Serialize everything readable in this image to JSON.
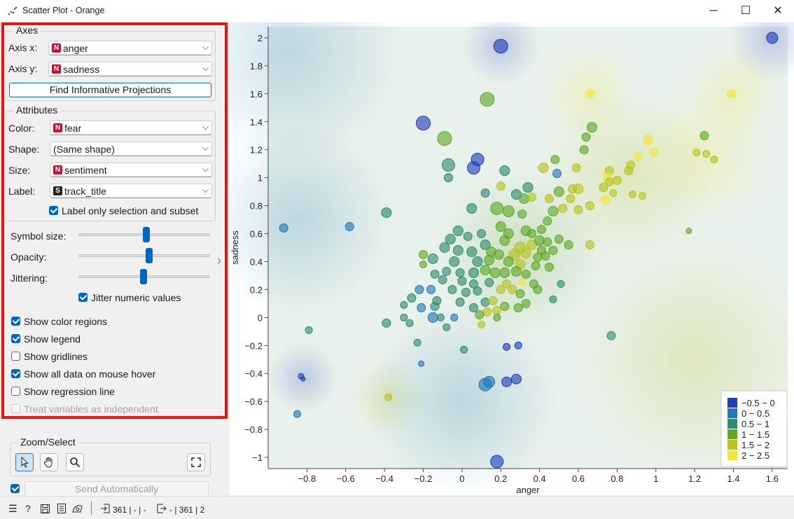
{
  "window": {
    "title": "Scatter Plot - Orange",
    "minimize": "─",
    "maximize": "☐",
    "close": "✕"
  },
  "axes": {
    "group_title": "Axes",
    "x_label": "Axis x:",
    "x_value": "anger",
    "y_label": "Axis y:",
    "y_value": "sadness",
    "find_button": "Find Informative Projections"
  },
  "attributes": {
    "group_title": "Attributes",
    "color_label": "Color:",
    "color_value": "fear",
    "shape_label": "Shape:",
    "shape_value": "(Same shape)",
    "size_label": "Size:",
    "size_value": "sentiment",
    "label_label": "Label:",
    "label_value": "track_title",
    "label_only_selection": "Label only selection and subset",
    "badge_numeric": "N",
    "badge_string": "S"
  },
  "sliders": {
    "symbol_size_label": "Symbol size:",
    "symbol_size": 0.76,
    "opacity_label": "Opacity:",
    "opacity": 0.78,
    "jittering_label": "Jittering:",
    "jittering": 0.74,
    "jitter_numeric": "Jitter numeric values"
  },
  "options": {
    "show_color_regions": "Show color regions",
    "show_legend": "Show legend",
    "show_gridlines": "Show gridlines",
    "show_all_data": "Show all data on mouse hover",
    "show_regression": "Show regression line",
    "treat_independent": "Treat variables as independent"
  },
  "zoom": {
    "group_title": "Zoom/Select",
    "select_icon": "pointer-icon",
    "pan_icon": "hand-icon",
    "zoom_icon": "magnifier-icon",
    "reset_icon": "fullscreen-icon"
  },
  "send": {
    "label": "Send Automatically"
  },
  "status": {
    "input_count": "361 | - | -",
    "output_count": "- | 361 | 2"
  },
  "chart_data": {
    "type": "scatter",
    "xlabel": "anger",
    "ylabel": "sadness",
    "xlim": [
      -1.0,
      1.68
    ],
    "ylim": [
      -1.08,
      2.08
    ],
    "xticks": [
      "−0.8",
      "−0.6",
      "−0.4",
      "−0.2",
      "0",
      "0.2",
      "0.4",
      "0.6",
      "0.8",
      "1",
      "1.2",
      "1.4",
      "1.6"
    ],
    "xtick_values": [
      -0.8,
      -0.6,
      -0.4,
      -0.2,
      0,
      0.2,
      0.4,
      0.6,
      0.8,
      1,
      1.2,
      1.4,
      1.6
    ],
    "yticks": [
      "2",
      "1.8",
      "1.6",
      "1.4",
      "1.2",
      "1",
      "0.8",
      "0.6",
      "0.4",
      "0.2",
      "0",
      "−0.2",
      "−0.4",
      "−0.6",
      "−0.8",
      "−1"
    ],
    "ytick_values": [
      2,
      1.8,
      1.6,
      1.4,
      1.2,
      1,
      0.8,
      0.6,
      0.4,
      0.2,
      0,
      -0.2,
      -0.4,
      -0.6,
      -0.8,
      -1
    ],
    "legend_position": "bottom-right",
    "legend": [
      "−0.5 − 0",
      "0 − 0.5",
      "0.5 − 1",
      "1 − 1.5",
      "1.5 − 2",
      "2 − 2.5"
    ],
    "legend_colors": [
      "#1f3fb8",
      "#1f78b4",
      "#2e8b6e",
      "#5ea826",
      "#b8c41a",
      "#f2e43a"
    ],
    "points": [
      {
        "x": 1.6,
        "y": 2.0,
        "s": 8,
        "c": 0
      },
      {
        "x": 0.2,
        "y": 1.94,
        "s": 10,
        "c": 0
      },
      {
        "x": 0.13,
        "y": 1.56,
        "s": 10,
        "c": 3
      },
      {
        "x": 0.66,
        "y": 1.6,
        "s": 6,
        "c": 5
      },
      {
        "x": 1.39,
        "y": 1.6,
        "s": 6,
        "c": 5
      },
      {
        "x": -0.2,
        "y": 1.39,
        "s": 10,
        "c": 0
      },
      {
        "x": -0.09,
        "y": 1.28,
        "s": 10,
        "c": 3
      },
      {
        "x": 0.67,
        "y": 1.36,
        "s": 7,
        "c": 3
      },
      {
        "x": 0.64,
        "y": 1.29,
        "s": 6,
        "c": 3
      },
      {
        "x": 0.63,
        "y": 1.2,
        "s": 6,
        "c": 3
      },
      {
        "x": 1.25,
        "y": 1.3,
        "s": 6,
        "c": 3
      },
      {
        "x": 0.96,
        "y": 1.27,
        "s": 7,
        "c": 5
      },
      {
        "x": 0.91,
        "y": 1.15,
        "s": 6,
        "c": 5
      },
      {
        "x": 0.99,
        "y": 1.18,
        "s": 6,
        "c": 5
      },
      {
        "x": 1.21,
        "y": 1.18,
        "s": 5,
        "c": 4
      },
      {
        "x": 1.26,
        "y": 1.17,
        "s": 5,
        "c": 4
      },
      {
        "x": 1.3,
        "y": 1.13,
        "s": 5,
        "c": 4
      },
      {
        "x": 0.08,
        "y": 1.13,
        "s": 9,
        "c": 0
      },
      {
        "x": 0.06,
        "y": 1.07,
        "s": 9,
        "c": 0
      },
      {
        "x": -0.07,
        "y": 1.09,
        "s": 9,
        "c": 2
      },
      {
        "x": -0.07,
        "y": 1.0,
        "s": 6,
        "c": 2
      },
      {
        "x": 0.22,
        "y": 1.05,
        "s": 7,
        "c": 2
      },
      {
        "x": 0.49,
        "y": 1.03,
        "s": 6,
        "c": 1
      },
      {
        "x": 0.42,
        "y": 1.07,
        "s": 7,
        "c": 4
      },
      {
        "x": 0.48,
        "y": 1.13,
        "s": 6,
        "c": 3
      },
      {
        "x": 0.59,
        "y": 1.07,
        "s": 6,
        "c": 4
      },
      {
        "x": 0.76,
        "y": 1.05,
        "s": 6,
        "c": 4
      },
      {
        "x": 0.87,
        "y": 1.09,
        "s": 6,
        "c": 4
      },
      {
        "x": 0.86,
        "y": 1.05,
        "s": 6,
        "c": 4
      },
      {
        "x": 0.75,
        "y": 1.0,
        "s": 6,
        "c": 5
      },
      {
        "x": 0.76,
        "y": 0.97,
        "s": 6,
        "c": 4
      },
      {
        "x": 0.8,
        "y": 0.98,
        "s": 6,
        "c": 4
      },
      {
        "x": 0.73,
        "y": 0.93,
        "s": 6,
        "c": 4
      },
      {
        "x": 0.78,
        "y": 0.89,
        "s": 5,
        "c": 4
      },
      {
        "x": 0.88,
        "y": 0.88,
        "s": 5,
        "c": 4
      },
      {
        "x": 0.93,
        "y": 0.87,
        "s": 5,
        "c": 4
      },
      {
        "x": 0.74,
        "y": 0.84,
        "s": 6,
        "c": 5
      },
      {
        "x": 0.66,
        "y": 0.8,
        "s": 6,
        "c": 4
      },
      {
        "x": 0.6,
        "y": 0.92,
        "s": 7,
        "c": 4
      },
      {
        "x": 0.57,
        "y": 0.92,
        "s": 6,
        "c": 4
      },
      {
        "x": 0.5,
        "y": 0.9,
        "s": 7,
        "c": 3
      },
      {
        "x": 0.34,
        "y": 0.93,
        "s": 7,
        "c": 2
      },
      {
        "x": 0.28,
        "y": 0.88,
        "s": 7,
        "c": 2
      },
      {
        "x": 0.2,
        "y": 0.94,
        "s": 6,
        "c": 4
      },
      {
        "x": 0.12,
        "y": 0.89,
        "s": 6,
        "c": 2
      },
      {
        "x": 0.32,
        "y": 0.85,
        "s": 7,
        "c": 3
      },
      {
        "x": 0.36,
        "y": 0.86,
        "s": 6,
        "c": 4
      },
      {
        "x": 0.45,
        "y": 0.85,
        "s": 6,
        "c": 4
      },
      {
        "x": 0.56,
        "y": 0.85,
        "s": 6,
        "c": 4
      },
      {
        "x": 0.47,
        "y": 0.76,
        "s": 7,
        "c": 3
      },
      {
        "x": 0.52,
        "y": 0.78,
        "s": 6,
        "c": 4
      },
      {
        "x": 0.6,
        "y": 0.77,
        "s": 6,
        "c": 4
      },
      {
        "x": -0.39,
        "y": 0.75,
        "s": 7,
        "c": 2
      },
      {
        "x": -0.92,
        "y": 0.64,
        "s": 6,
        "c": 1
      },
      {
        "x": -0.58,
        "y": 0.65,
        "s": 6,
        "c": 1
      },
      {
        "x": 0.05,
        "y": 0.78,
        "s": 7,
        "c": 2
      },
      {
        "x": 0.18,
        "y": 0.78,
        "s": 9,
        "c": 3
      },
      {
        "x": 0.24,
        "y": 0.76,
        "s": 8,
        "c": 3
      },
      {
        "x": 0.31,
        "y": 0.74,
        "s": 6,
        "c": 3
      },
      {
        "x": 0.44,
        "y": 0.69,
        "s": 6,
        "c": 3
      },
      {
        "x": 0.41,
        "y": 0.63,
        "s": 6,
        "c": 3
      },
      {
        "x": 1.17,
        "y": 0.62,
        "s": 4,
        "c": 3
      },
      {
        "x": -0.02,
        "y": 0.62,
        "s": 7,
        "c": 2
      },
      {
        "x": 0.03,
        "y": 0.58,
        "s": 6,
        "c": 2
      },
      {
        "x": 0.1,
        "y": 0.6,
        "s": 6,
        "c": 2
      },
      {
        "x": 0.2,
        "y": 0.65,
        "s": 7,
        "c": 3
      },
      {
        "x": 0.24,
        "y": 0.6,
        "s": 7,
        "c": 3
      },
      {
        "x": 0.33,
        "y": 0.62,
        "s": 7,
        "c": 3
      },
      {
        "x": 0.36,
        "y": 0.6,
        "s": 6,
        "c": 3
      },
      {
        "x": -0.06,
        "y": 0.56,
        "s": 7,
        "c": 2
      },
      {
        "x": 0.12,
        "y": 0.52,
        "s": 7,
        "c": 2
      },
      {
        "x": 0.22,
        "y": 0.55,
        "s": 7,
        "c": 3
      },
      {
        "x": 0.3,
        "y": 0.5,
        "s": 8,
        "c": 4
      },
      {
        "x": 0.36,
        "y": 0.52,
        "s": 7,
        "c": 4
      },
      {
        "x": 0.4,
        "y": 0.55,
        "s": 7,
        "c": 3
      },
      {
        "x": 0.41,
        "y": 0.48,
        "s": 6,
        "c": 3
      },
      {
        "x": 0.44,
        "y": 0.54,
        "s": 6,
        "c": 3
      },
      {
        "x": 0.5,
        "y": 0.56,
        "s": 6,
        "c": 3
      },
      {
        "x": 0.55,
        "y": 0.52,
        "s": 6,
        "c": 3
      },
      {
        "x": 0.66,
        "y": 0.52,
        "s": 6,
        "c": 4
      },
      {
        "x": -0.09,
        "y": 0.5,
        "s": 7,
        "c": 2
      },
      {
        "x": -0.02,
        "y": 0.48,
        "s": 7,
        "c": 2
      },
      {
        "x": 0.05,
        "y": 0.47,
        "s": 7,
        "c": 2
      },
      {
        "x": 0.15,
        "y": 0.47,
        "s": 7,
        "c": 3
      },
      {
        "x": 0.19,
        "y": 0.45,
        "s": 7,
        "c": 3
      },
      {
        "x": 0.27,
        "y": 0.45,
        "s": 8,
        "c": 4
      },
      {
        "x": 0.33,
        "y": 0.46,
        "s": 7,
        "c": 4
      },
      {
        "x": 0.39,
        "y": 0.43,
        "s": 6,
        "c": 3
      },
      {
        "x": 0.43,
        "y": 0.44,
        "s": 6,
        "c": 3
      },
      {
        "x": 0.47,
        "y": 0.48,
        "s": 6,
        "c": 3
      },
      {
        "x": -0.2,
        "y": 0.45,
        "s": 6,
        "c": 3
      },
      {
        "x": -0.2,
        "y": 0.38,
        "s": 5,
        "c": 3
      },
      {
        "x": -0.15,
        "y": 0.42,
        "s": 7,
        "c": 2
      },
      {
        "x": -0.04,
        "y": 0.4,
        "s": 7,
        "c": 2
      },
      {
        "x": 0.08,
        "y": 0.4,
        "s": 7,
        "c": 2
      },
      {
        "x": 0.14,
        "y": 0.41,
        "s": 7,
        "c": 3
      },
      {
        "x": 0.24,
        "y": 0.4,
        "s": 7,
        "c": 3
      },
      {
        "x": 0.3,
        "y": 0.38,
        "s": 7,
        "c": 4
      },
      {
        "x": 0.38,
        "y": 0.37,
        "s": 6,
        "c": 3
      },
      {
        "x": 0.45,
        "y": 0.36,
        "s": 6,
        "c": 3
      },
      {
        "x": -0.14,
        "y": 0.31,
        "s": 6,
        "c": 2
      },
      {
        "x": -0.08,
        "y": 0.33,
        "s": 6,
        "c": 2
      },
      {
        "x": -0.01,
        "y": 0.32,
        "s": 6,
        "c": 2
      },
      {
        "x": 0.06,
        "y": 0.32,
        "s": 7,
        "c": 2
      },
      {
        "x": 0.12,
        "y": 0.34,
        "s": 7,
        "c": 3
      },
      {
        "x": 0.17,
        "y": 0.32,
        "s": 7,
        "c": 3
      },
      {
        "x": 0.22,
        "y": 0.32,
        "s": 7,
        "c": 3
      },
      {
        "x": 0.28,
        "y": 0.33,
        "s": 7,
        "c": 3
      },
      {
        "x": 0.33,
        "y": 0.31,
        "s": 6,
        "c": 3
      },
      {
        "x": -0.1,
        "y": 0.27,
        "s": 6,
        "c": 2
      },
      {
        "x": 0.0,
        "y": 0.26,
        "s": 6,
        "c": 2
      },
      {
        "x": 0.06,
        "y": 0.24,
        "s": 6,
        "c": 2
      },
      {
        "x": 0.14,
        "y": 0.25,
        "s": 6,
        "c": 2
      },
      {
        "x": 0.23,
        "y": 0.24,
        "s": 6,
        "c": 4
      },
      {
        "x": 0.31,
        "y": 0.25,
        "s": 5,
        "c": 5
      },
      {
        "x": 0.37,
        "y": 0.24,
        "s": 6,
        "c": 3
      },
      {
        "x": 0.51,
        "y": 0.24,
        "s": 5,
        "c": 2
      },
      {
        "x": -0.22,
        "y": 0.2,
        "s": 6,
        "c": 1
      },
      {
        "x": -0.16,
        "y": 0.2,
        "s": 6,
        "c": 1
      },
      {
        "x": -0.05,
        "y": 0.2,
        "s": 6,
        "c": 2
      },
      {
        "x": 0.02,
        "y": 0.18,
        "s": 6,
        "c": 2
      },
      {
        "x": 0.08,
        "y": 0.19,
        "s": 6,
        "c": 2
      },
      {
        "x": 0.2,
        "y": 0.2,
        "s": 6,
        "c": 4
      },
      {
        "x": 0.26,
        "y": 0.2,
        "s": 6,
        "c": 4
      },
      {
        "x": 0.3,
        "y": 0.17,
        "s": 6,
        "c": 3
      },
      {
        "x": 0.39,
        "y": 0.2,
        "s": 6,
        "c": 3
      },
      {
        "x": -0.26,
        "y": 0.14,
        "s": 6,
        "c": 2
      },
      {
        "x": -0.13,
        "y": 0.12,
        "s": 6,
        "c": 2
      },
      {
        "x": -0.01,
        "y": 0.11,
        "s": 6,
        "c": 2
      },
      {
        "x": 0.12,
        "y": 0.11,
        "s": 6,
        "c": 2
      },
      {
        "x": 0.16,
        "y": 0.12,
        "s": 6,
        "c": 4
      },
      {
        "x": 0.22,
        "y": 0.08,
        "s": 6,
        "c": 3
      },
      {
        "x": 0.33,
        "y": 0.1,
        "s": 6,
        "c": 3
      },
      {
        "x": 0.47,
        "y": 0.13,
        "s": 5,
        "c": 2
      },
      {
        "x": -0.3,
        "y": 0.09,
        "s": 5,
        "c": 2
      },
      {
        "x": -0.21,
        "y": 0.07,
        "s": 6,
        "c": 1
      },
      {
        "x": -0.14,
        "y": 0.08,
        "s": 6,
        "c": 2
      },
      {
        "x": 0.06,
        "y": 0.07,
        "s": 6,
        "c": 2
      },
      {
        "x": 0.13,
        "y": 0.04,
        "s": 6,
        "c": 4
      },
      {
        "x": 0.18,
        "y": 0.05,
        "s": 6,
        "c": 4
      },
      {
        "x": 0.29,
        "y": 0.07,
        "s": 6,
        "c": 3
      },
      {
        "x": -0.15,
        "y": 0.0,
        "s": 7,
        "c": 1
      },
      {
        "x": -0.11,
        "y": 0.0,
        "s": 5,
        "c": 2
      },
      {
        "x": -0.04,
        "y": 0.0,
        "s": 5,
        "c": 1
      },
      {
        "x": 0.09,
        "y": 0.02,
        "s": 6,
        "c": 3
      },
      {
        "x": 0.18,
        "y": 0.0,
        "s": 5,
        "c": 3
      },
      {
        "x": -0.39,
        "y": -0.04,
        "s": 6,
        "c": 2
      },
      {
        "x": -0.3,
        "y": 0.0,
        "s": 5,
        "c": 2
      },
      {
        "x": -0.27,
        "y": -0.04,
        "s": 5,
        "c": 2
      },
      {
        "x": -0.08,
        "y": -0.07,
        "s": 5,
        "c": 2
      },
      {
        "x": 0.1,
        "y": -0.05,
        "s": 5,
        "c": 4
      },
      {
        "x": -0.79,
        "y": -0.09,
        "s": 5,
        "c": 2
      },
      {
        "x": 0.77,
        "y": -0.13,
        "s": 6,
        "c": 2
      },
      {
        "x": -0.23,
        "y": -0.18,
        "s": 5,
        "c": 2
      },
      {
        "x": 0.01,
        "y": -0.23,
        "s": 5,
        "c": 2
      },
      {
        "x": 0.23,
        "y": -0.21,
        "s": 5,
        "c": 0
      },
      {
        "x": 0.29,
        "y": -0.2,
        "s": 5,
        "c": 0
      },
      {
        "x": -0.21,
        "y": -0.33,
        "s": 4,
        "c": 1
      },
      {
        "x": 0.12,
        "y": -0.48,
        "s": 9,
        "c": 1
      },
      {
        "x": 0.14,
        "y": -0.46,
        "s": 8,
        "c": 1
      },
      {
        "x": 0.23,
        "y": -0.46,
        "s": 7,
        "c": 0
      },
      {
        "x": 0.28,
        "y": -0.44,
        "s": 7,
        "c": 0
      },
      {
        "x": -0.83,
        "y": -0.42,
        "s": 4,
        "c": 0
      },
      {
        "x": -0.82,
        "y": -0.44,
        "s": 3,
        "c": 0
      },
      {
        "x": -0.38,
        "y": -0.57,
        "s": 5,
        "c": 4
      },
      {
        "x": -0.85,
        "y": -0.69,
        "s": 5,
        "c": 1
      },
      {
        "x": 0.18,
        "y": -1.03,
        "s": 9,
        "c": 0
      }
    ],
    "regions": [
      {
        "x": 1.6,
        "y": 2.0,
        "r": 0.22,
        "c": 0
      },
      {
        "x": 0.2,
        "y": 1.94,
        "r": 0.2,
        "c": 0
      },
      {
        "x": -0.9,
        "y": 1.9,
        "r": 0.6,
        "c": 1
      },
      {
        "x": -0.85,
        "y": 0.7,
        "r": 0.5,
        "c": 1
      },
      {
        "x": -0.82,
        "y": -0.43,
        "r": 0.18,
        "c": 0
      },
      {
        "x": -0.38,
        "y": -0.57,
        "r": 0.2,
        "c": 4
      },
      {
        "x": 0.3,
        "y": 0.45,
        "r": 0.45,
        "c": 3
      },
      {
        "x": 0.85,
        "y": 1.0,
        "r": 0.45,
        "c": 4
      },
      {
        "x": 1.25,
        "y": 1.15,
        "r": 0.35,
        "c": 5
      },
      {
        "x": 0.66,
        "y": 1.6,
        "r": 0.25,
        "c": 5
      },
      {
        "x": 1.4,
        "y": 1.6,
        "r": 0.25,
        "c": 5
      },
      {
        "x": 1.2,
        "y": -0.3,
        "r": 0.6,
        "c": 4
      },
      {
        "x": 0.0,
        "y": -0.6,
        "r": 0.5,
        "c": 1
      }
    ]
  }
}
